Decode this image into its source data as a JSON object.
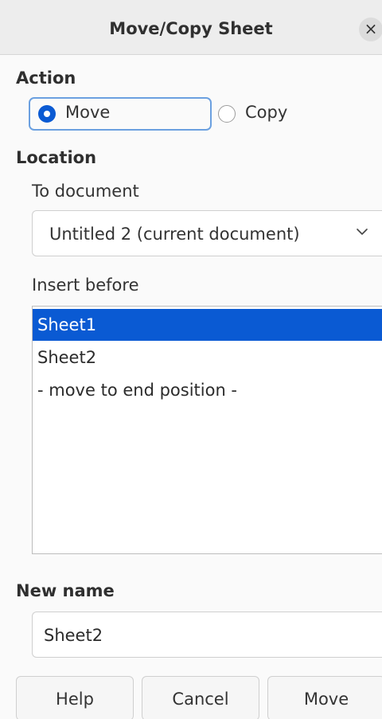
{
  "dialog": {
    "title": "Move/Copy Sheet",
    "close_icon": "close-icon",
    "close_glyph": "×"
  },
  "action": {
    "label": "Action",
    "options": [
      {
        "label": "Move",
        "selected": true
      },
      {
        "label": "Copy",
        "selected": false
      }
    ]
  },
  "location": {
    "label": "Location",
    "to_document_label": "To document",
    "to_document_value": "Untitled 2 (current document)",
    "insert_before_label": "Insert before",
    "insert_before_items": [
      {
        "label": "Sheet1",
        "selected": true
      },
      {
        "label": "Sheet2",
        "selected": false
      },
      {
        "label": "- move to end position -",
        "selected": false
      }
    ]
  },
  "new_name": {
    "label": "New name",
    "value": "Sheet2"
  },
  "buttons": {
    "help": "Help",
    "cancel": "Cancel",
    "move": "Move"
  },
  "colors": {
    "accent": "#0a5ad3",
    "focus_ring": "#6ba0e0",
    "titlebar_bg": "#ededed",
    "dialog_bg": "#fafafa"
  }
}
